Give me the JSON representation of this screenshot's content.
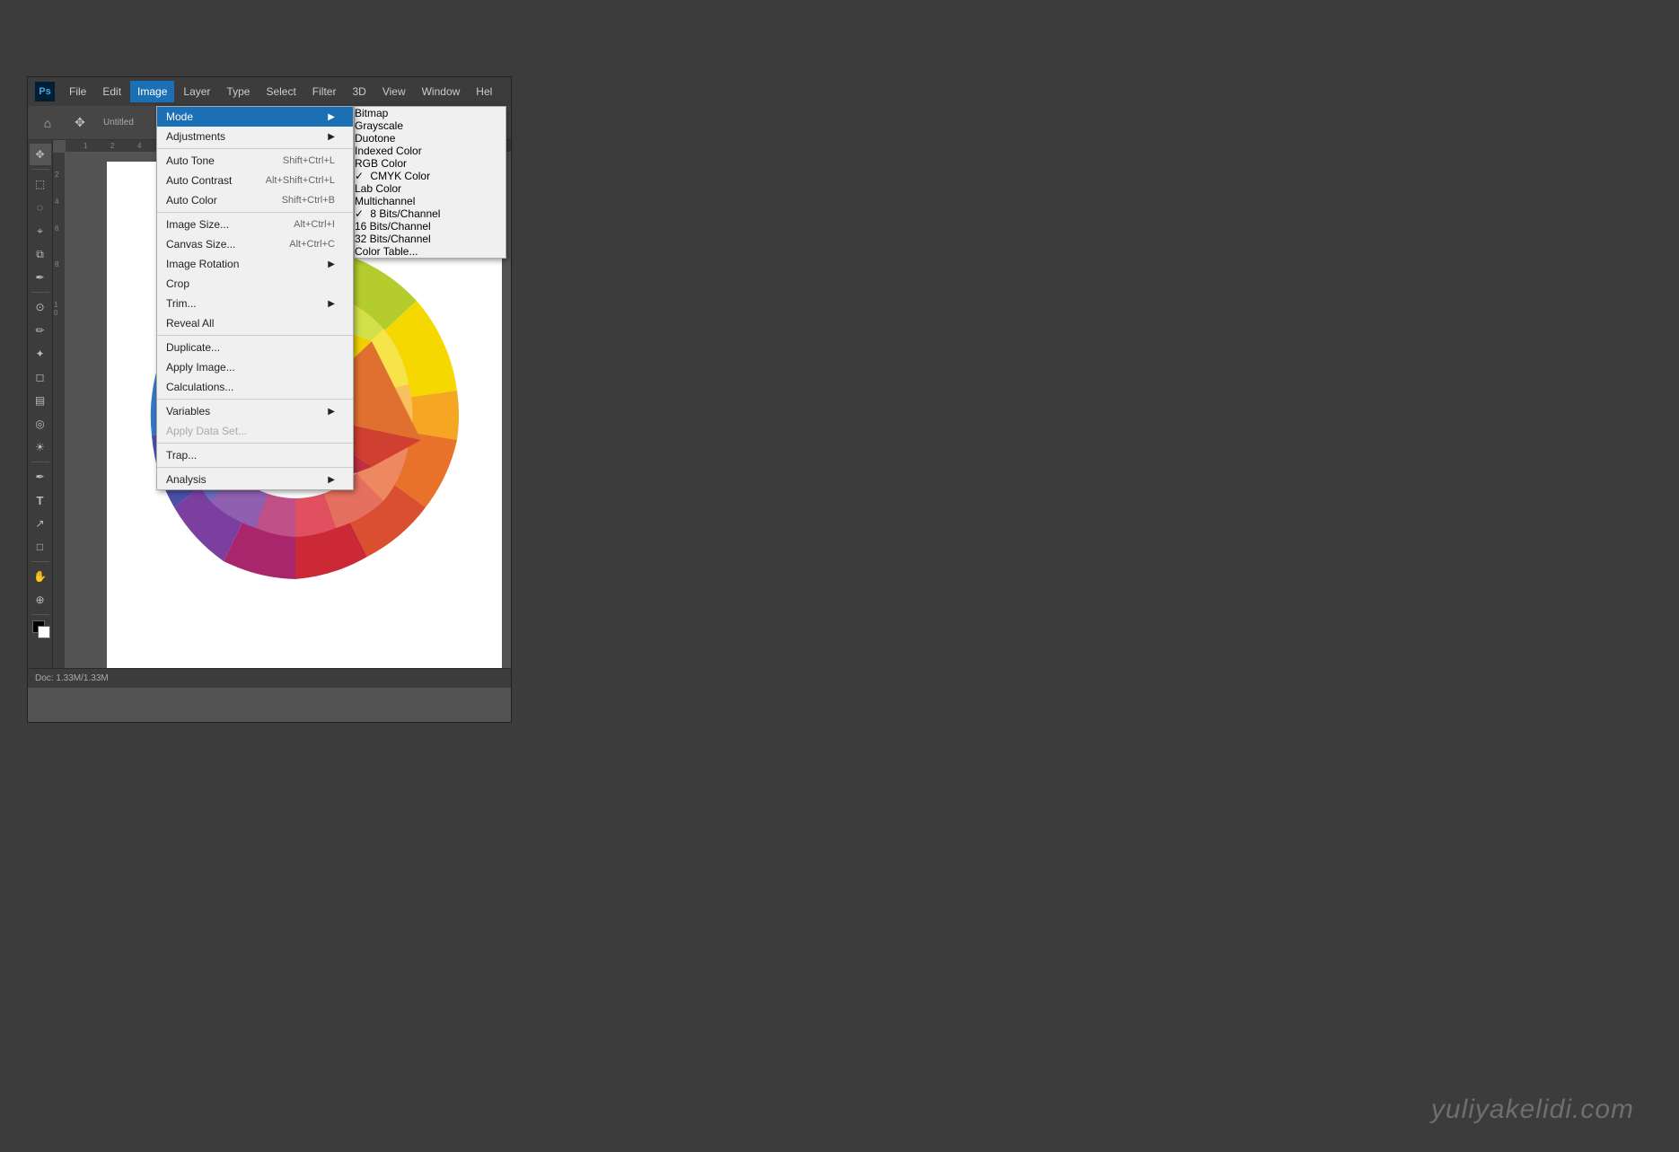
{
  "app": {
    "title": "Photoshop",
    "logo": "Ps"
  },
  "menubar": {
    "items": [
      {
        "label": "File",
        "id": "file"
      },
      {
        "label": "Edit",
        "id": "edit"
      },
      {
        "label": "Image",
        "id": "image",
        "active": true
      },
      {
        "label": "Layer",
        "id": "layer"
      },
      {
        "label": "Type",
        "id": "type"
      },
      {
        "label": "Select",
        "id": "select"
      },
      {
        "label": "Filter",
        "id": "filter"
      },
      {
        "label": "3D",
        "id": "3d"
      },
      {
        "label": "View",
        "id": "view"
      },
      {
        "label": "Window",
        "id": "window"
      },
      {
        "label": "Hel",
        "id": "help"
      }
    ]
  },
  "tab": {
    "label": "Untitled"
  },
  "image_menu": {
    "items": [
      {
        "label": "Mode",
        "id": "mode",
        "active": true,
        "hasArrow": true
      },
      {
        "label": "Adjustments",
        "id": "adjustments",
        "hasArrow": true
      },
      {
        "separator": true
      },
      {
        "label": "Auto Tone",
        "id": "auto-tone",
        "shortcut": "Shift+Ctrl+L"
      },
      {
        "label": "Auto Contrast",
        "id": "auto-contrast",
        "shortcut": "Alt+Shift+Ctrl+L"
      },
      {
        "label": "Auto Color",
        "id": "auto-color",
        "shortcut": "Shift+Ctrl+B"
      },
      {
        "separator": true
      },
      {
        "label": "Image Size...",
        "id": "image-size",
        "shortcut": "Alt+Ctrl+I"
      },
      {
        "label": "Canvas Size...",
        "id": "canvas-size",
        "shortcut": "Alt+Ctrl+C"
      },
      {
        "label": "Image Rotation",
        "id": "image-rotation",
        "hasArrow": true
      },
      {
        "label": "Crop",
        "id": "crop"
      },
      {
        "label": "Trim...",
        "id": "trim",
        "hasArrow": true
      },
      {
        "label": "Reveal All",
        "id": "reveal-all"
      },
      {
        "separator": true
      },
      {
        "label": "Duplicate...",
        "id": "duplicate"
      },
      {
        "label": "Apply Image...",
        "id": "apply-image"
      },
      {
        "label": "Calculations...",
        "id": "calculations"
      },
      {
        "separator": true
      },
      {
        "label": "Variables",
        "id": "variables",
        "hasArrow": true
      },
      {
        "label": "Apply Data Set...",
        "id": "apply-data-set",
        "disabled": true
      },
      {
        "separator": true
      },
      {
        "label": "Trap...",
        "id": "trap"
      },
      {
        "separator": true
      },
      {
        "label": "Analysis",
        "id": "analysis",
        "hasArrow": true
      }
    ]
  },
  "mode_submenu": {
    "items": [
      {
        "label": "Bitmap",
        "id": "bitmap"
      },
      {
        "label": "Grayscale",
        "id": "grayscale"
      },
      {
        "label": "Duotone",
        "id": "duotone",
        "disabled": true
      },
      {
        "label": "Indexed Color",
        "id": "indexed-color",
        "disabled": true
      },
      {
        "label": "RGB Color",
        "id": "rgb-color"
      },
      {
        "label": "CMYK Color",
        "id": "cmyk-color",
        "highlighted": true
      },
      {
        "label": "Lab Color",
        "id": "lab-color"
      },
      {
        "label": "Multichannel",
        "id": "multichannel"
      },
      {
        "separator": true
      },
      {
        "label": "8 Bits/Channel",
        "id": "8-bits",
        "checked": true
      },
      {
        "label": "16 Bits/Channel",
        "id": "16-bits"
      },
      {
        "label": "32 Bits/Channel",
        "id": "32-bits"
      },
      {
        "separator": true
      },
      {
        "label": "Color Table...",
        "id": "color-table",
        "disabled": true
      }
    ]
  },
  "watermark": {
    "text": "yuliyakelidi.com"
  },
  "tools": [
    {
      "icon": "⊹",
      "name": "move"
    },
    {
      "icon": "⊹",
      "name": "artboard"
    },
    {
      "icon": "□",
      "name": "marquee"
    },
    {
      "icon": "◌",
      "name": "lasso"
    },
    {
      "icon": "⌖",
      "name": "quick-select"
    },
    {
      "icon": "✂",
      "name": "crop"
    },
    {
      "icon": "⊡",
      "name": "eyedropper"
    },
    {
      "icon": "⊘",
      "name": "healing"
    },
    {
      "icon": "✏",
      "name": "brush"
    },
    {
      "icon": "✒",
      "name": "clone"
    },
    {
      "icon": "◼",
      "name": "eraser"
    },
    {
      "icon": "▧",
      "name": "gradient"
    },
    {
      "icon": "◎",
      "name": "blur"
    },
    {
      "icon": "☀",
      "name": "dodge"
    },
    {
      "icon": "⬡",
      "name": "pen"
    },
    {
      "icon": "T",
      "name": "type"
    },
    {
      "icon": "↗",
      "name": "path-select"
    },
    {
      "icon": "□",
      "name": "shape"
    },
    {
      "icon": "☰",
      "name": "hand"
    },
    {
      "icon": "⊕",
      "name": "zoom"
    },
    {
      "icon": "■",
      "name": "fg-color"
    },
    {
      "icon": "◉",
      "name": "mode-toggle"
    }
  ]
}
